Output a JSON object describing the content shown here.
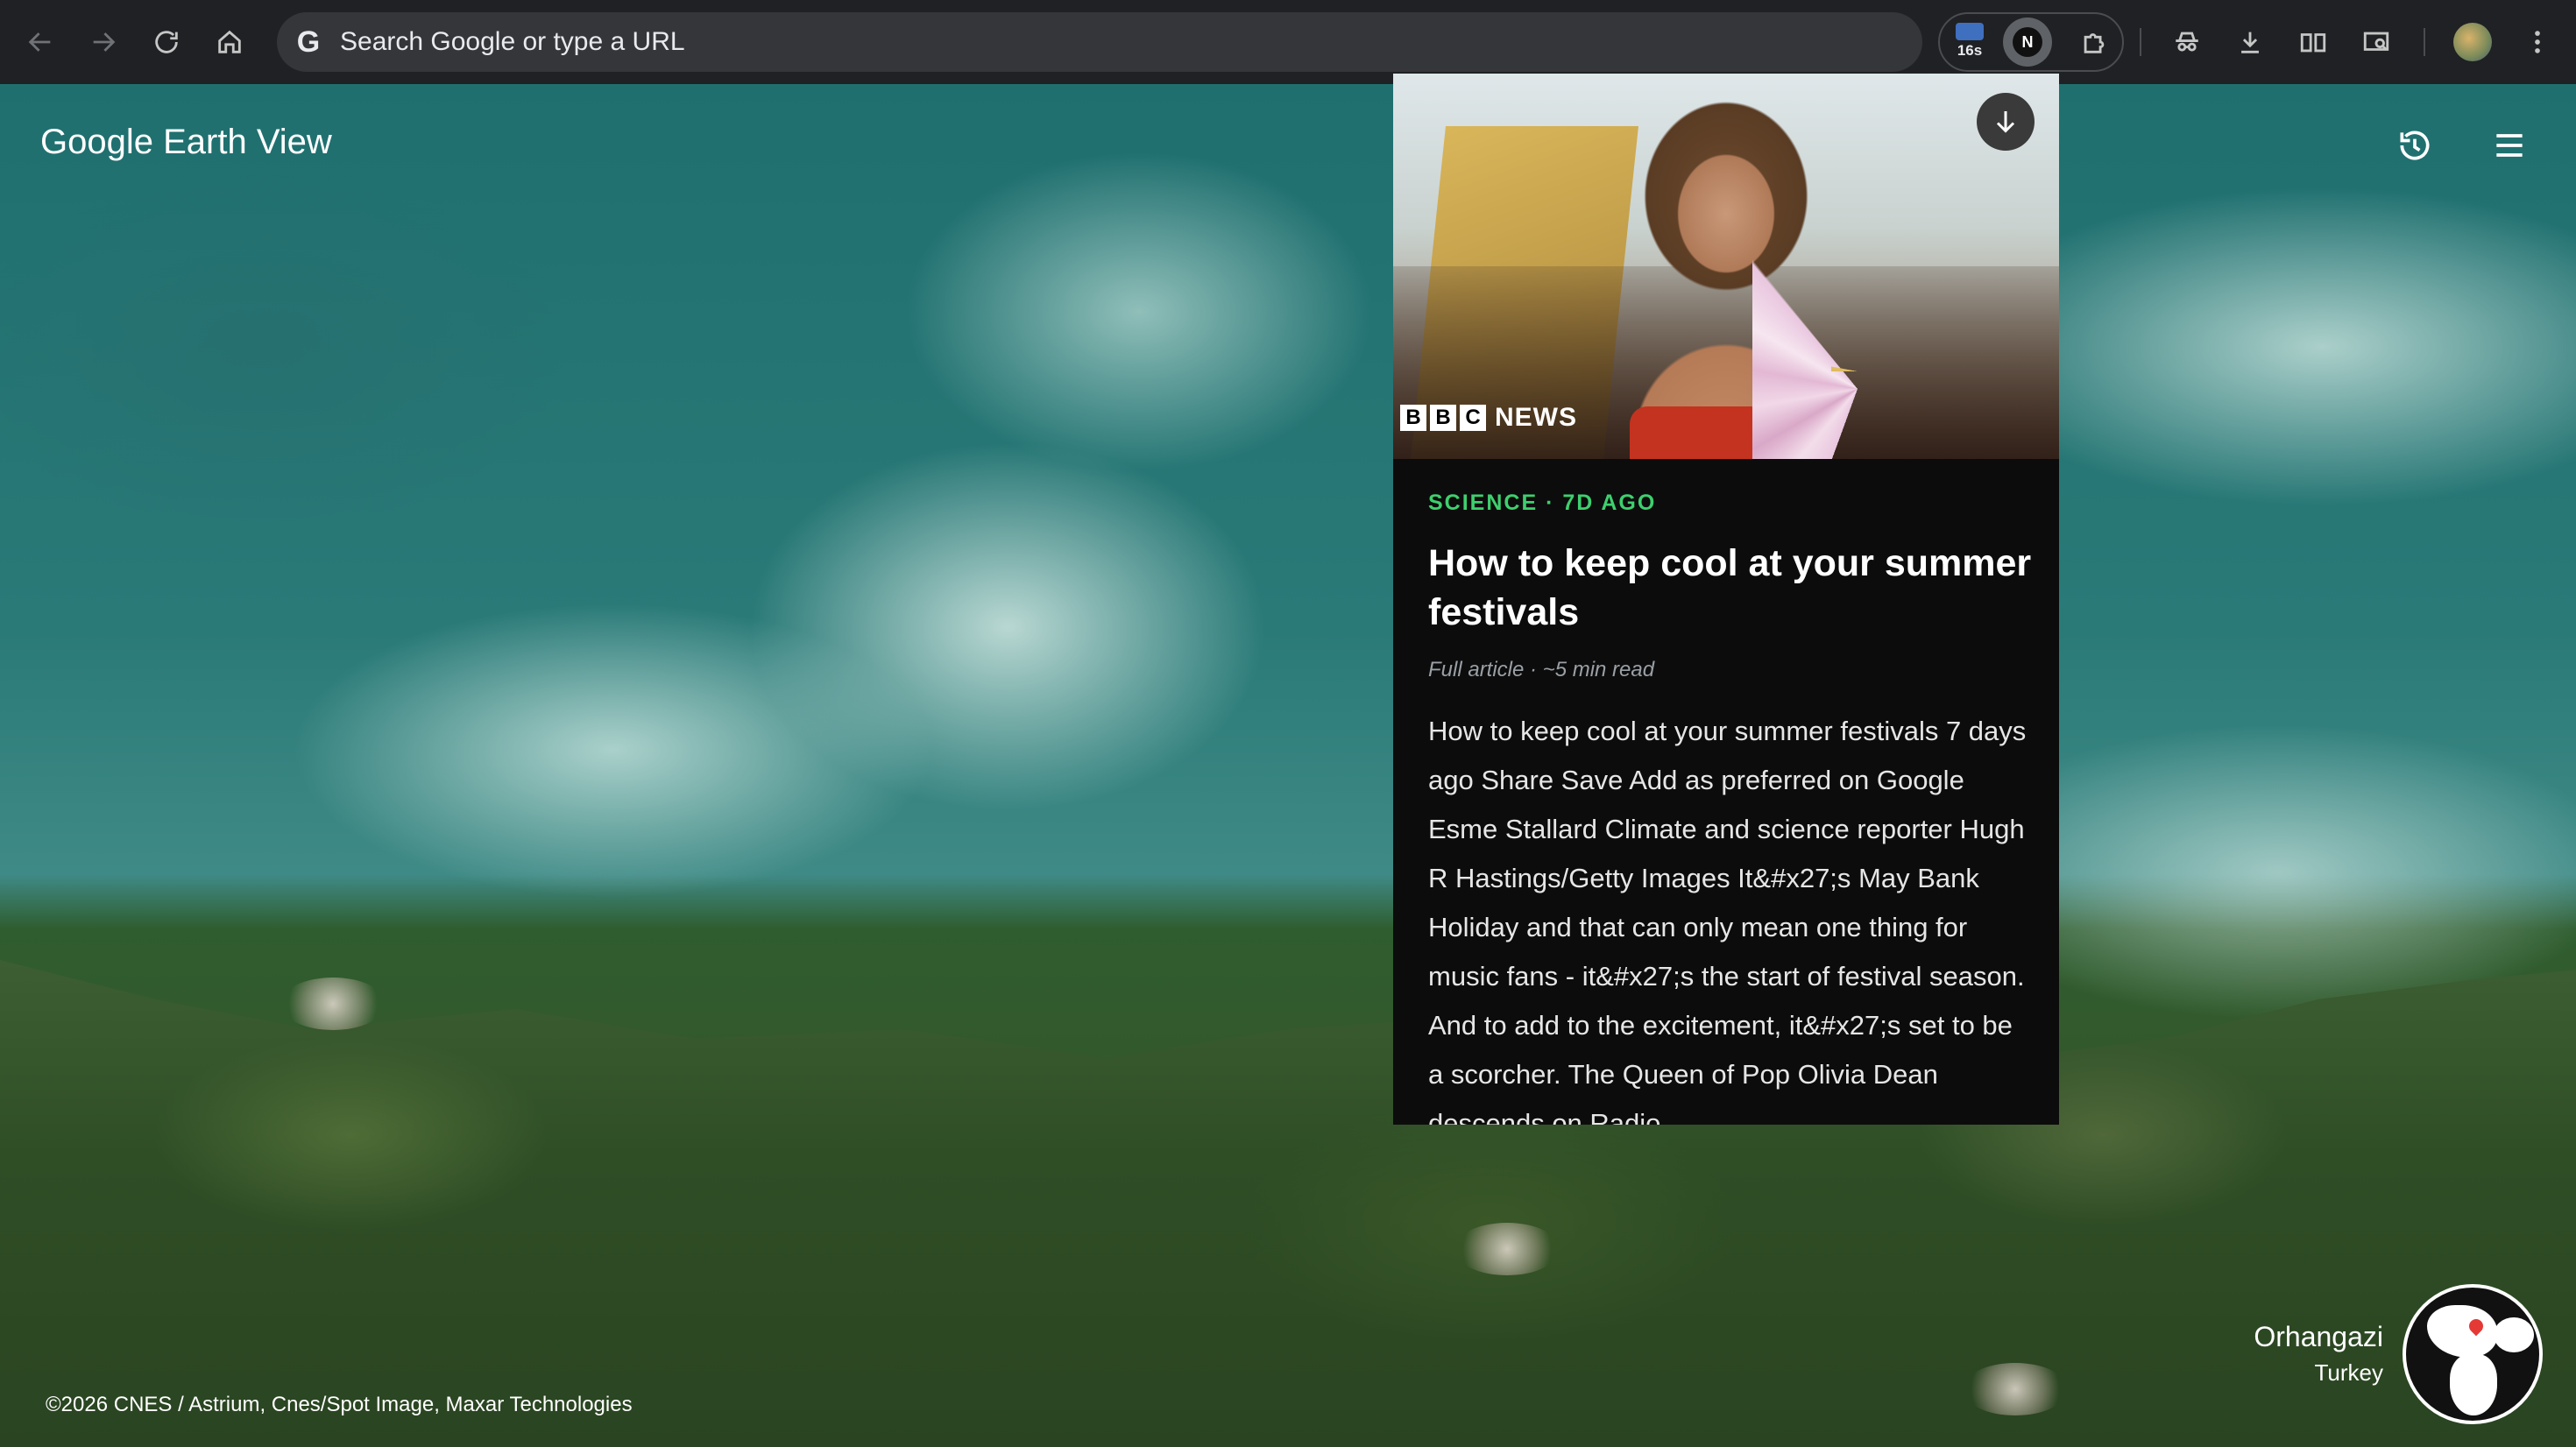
{
  "browser": {
    "omnibox_placeholder": "Search Google or type a URL",
    "omnibox_g": "G",
    "extension_badge": "16s",
    "extension_n": "N"
  },
  "earthview": {
    "brand": "Google Earth View",
    "copyright": "©2026 CNES / Astrium, Cnes/Spot Image, Maxar Technologies",
    "location_city": "Orhangazi",
    "location_country": "Turkey"
  },
  "article": {
    "source_logo_letters": [
      "B",
      "B",
      "C"
    ],
    "source_logo_word": "NEWS",
    "category_meta": "SCIENCE · 7D AGO",
    "title": "How to keep cool at your summer festivals",
    "read_info": "Full article · ~5 min read",
    "excerpt": "How to keep cool at your summer festivals 7 days ago Share Save Add as preferred on Google Esme Stallard Climate and science reporter Hugh R Hastings/Getty Images It&#x27;s May Bank Holiday and that can only mean one thing for music fans - it&#x27;s the start of festival season. And to add to the excitement, it&#x27;s set to be a scorcher. The Queen of Pop Olivia Dean descends on Radio"
  },
  "colors": {
    "toolbar_bg": "#202124",
    "omnibox_bg": "#35363a",
    "card_bg": "#0c0c0c",
    "category_accent": "#3ecf6e"
  },
  "icons": {
    "toolbar": [
      "back-arrow-icon",
      "forward-arrow-icon",
      "reload-icon",
      "home-icon",
      "extension-puzzle-icon",
      "incognito-icon",
      "download-icon",
      "reading-list-icon",
      "tab-search-icon",
      "kebab-menu-icon"
    ],
    "earthview": [
      "history-icon",
      "hamburger-menu-icon",
      "globe-icon"
    ],
    "card": [
      "download-arrow-icon"
    ]
  }
}
